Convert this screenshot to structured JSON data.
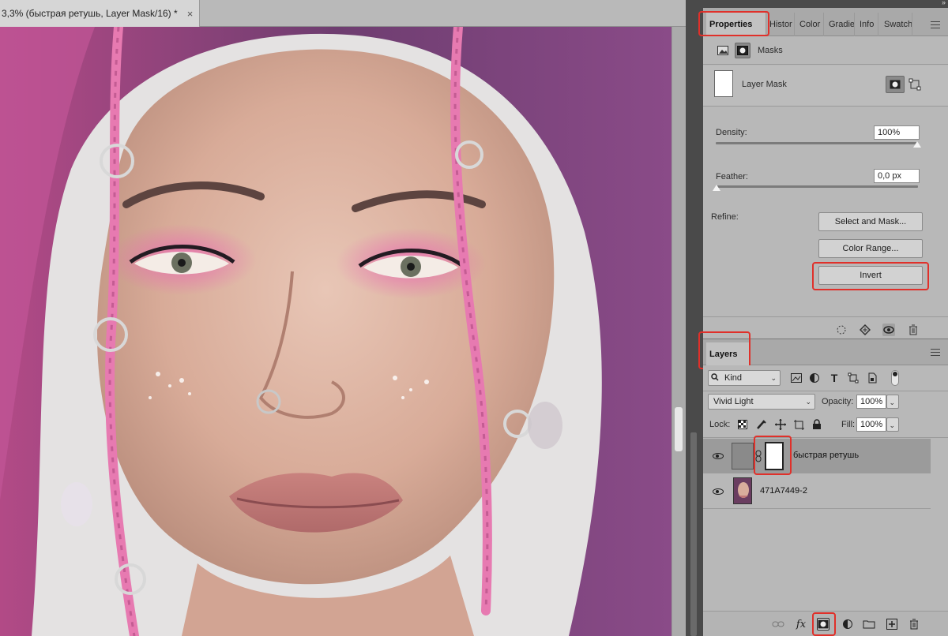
{
  "document": {
    "tab_title": "3,3% (быстрая ретушь, Layer Mask/16) *",
    "close_glyph": "×"
  },
  "panel_top": {
    "collapse_glyph": "››"
  },
  "properties_panel": {
    "tabs": [
      "Properties",
      "Histor",
      "Color",
      "Gradie",
      "Info",
      "Swatch"
    ],
    "active_tab": "Properties",
    "header_label": "Masks",
    "mask_label": "Layer Mask",
    "density": {
      "label": "Density:",
      "value": "100%",
      "level_fraction": 1.0
    },
    "feather": {
      "label": "Feather:",
      "value": "0,0 px",
      "level_fraction": 0.0
    },
    "refine_label": "Refine:",
    "buttons": {
      "select_and_mask": "Select and Mask...",
      "color_range": "Color Range...",
      "invert": "Invert"
    },
    "footer_icons": [
      "load-selection-icon",
      "apply-mask-icon",
      "visibility-icon",
      "trash-icon"
    ]
  },
  "layers_panel": {
    "tab_label": "Layers",
    "filter": {
      "value": "Kind",
      "icons": [
        "image-filter-icon",
        "adjustment-filter-icon",
        "type-filter-icon",
        "shape-filter-icon",
        "smart-object-filter-icon"
      ]
    },
    "blend_mode": "Vivid Light",
    "opacity": {
      "label": "Opacity:",
      "value": "100%"
    },
    "lock_label": "Lock:",
    "fill": {
      "label": "Fill:",
      "value": "100%"
    },
    "layers": [
      {
        "name": "быстрая ретушь",
        "selected": true,
        "has_mask": true
      },
      {
        "name": "471A7449-2",
        "selected": false,
        "has_mask": false
      }
    ],
    "footer_icons": [
      "link-layers-icon",
      "fx-icon",
      "add-mask-icon",
      "adjustment-layer-icon",
      "group-folder-icon",
      "new-layer-icon",
      "trash-icon"
    ],
    "fx_label": "fx"
  },
  "highlight_color": "#e0302a"
}
